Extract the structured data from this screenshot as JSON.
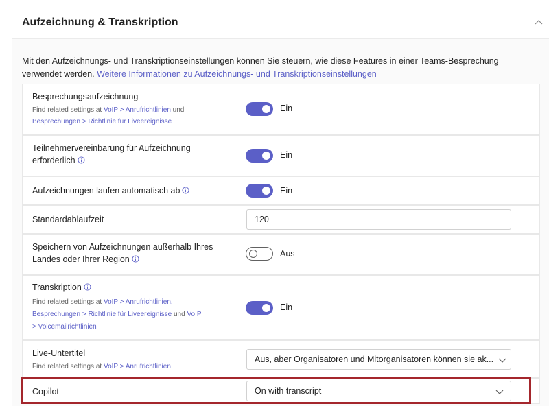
{
  "section": {
    "title": "Aufzeichnung & Transkription",
    "intro_text": "Mit den Aufzeichnungs- und Transkriptionseinstellungen können Sie steuern, wie diese Features in einer Teams-Besprechung verwendet werden. ",
    "intro_link": "Weitere Informationen zu Aufzeichnungs- und Transkriptionseinstellungen"
  },
  "rows": {
    "meeting_recording": {
      "label": "Besprechungsaufzeichnung",
      "sub_prefix": "Find related settings at ",
      "link1": "VoIP > Anrufrichtlinien",
      "sub_and": " und",
      "link2": "Besprechungen > Richtlinie für Liveereignisse",
      "state": "Ein"
    },
    "participant_agreement": {
      "label_line1": "Teilnehmervereinbarung für Aufzeichnung",
      "label_line2": "erforderlich",
      "state": "Ein"
    },
    "auto_expire": {
      "label": "Aufzeichnungen laufen automatisch ab",
      "state": "Ein"
    },
    "default_expiration": {
      "label": "Standardablaufzeit",
      "value": "120"
    },
    "store_outside": {
      "label_line1": "Speichern von Aufzeichnungen außerhalb Ihres",
      "label_line2": "Landes oder Ihrer Region",
      "state": "Aus"
    },
    "transcription": {
      "label": "Transkription",
      "sub_prefix": "Find related settings at ",
      "link1": "VoIP > Anrufrichtlinien,",
      "link2": "Besprechungen > Richtlinie für Liveereignisse",
      "sub_and": " und ",
      "link3a": "VoIP",
      "link3b": "> Voicemailrichtlinien",
      "state": "Ein"
    },
    "live_captions": {
      "label": "Live-Untertitel",
      "sub_prefix": "Find related settings at ",
      "link1": "VoIP > Anrufrichtlinien",
      "value": "Aus, aber Organisatoren und Mitorganisatoren können sie ak..."
    },
    "copilot": {
      "label": "Copilot",
      "value": "On with transcript"
    }
  },
  "colors": {
    "accent": "#5b5fc7",
    "highlight": "#a4262c"
  },
  "icons": {
    "collapse": "chevron-up-icon",
    "info": "info-icon",
    "dropdown": "chevron-down-icon"
  }
}
